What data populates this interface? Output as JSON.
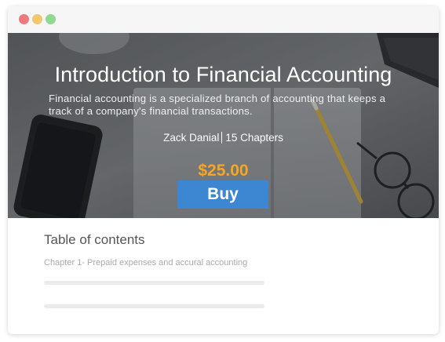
{
  "course": {
    "title": "Introduction to Financial Accounting",
    "description": "Financial accounting is a specialized branch of accounting that keeps a track of a company's financial transactions.",
    "author": "Zack Danial",
    "chapters": "15 Chapters",
    "price": "$25.00",
    "buy_label": "Buy"
  },
  "toc": {
    "heading": "Table of contents",
    "items": [
      {
        "label": "Chapter 1- Prepaid expenses and accural accounting"
      }
    ]
  },
  "colors": {
    "price": "#f5a623",
    "buy_button": "#3d86d1",
    "window_dot_red": "#ee7a7d",
    "window_dot_yellow": "#f2c86f",
    "window_dot_green": "#8fd991"
  }
}
